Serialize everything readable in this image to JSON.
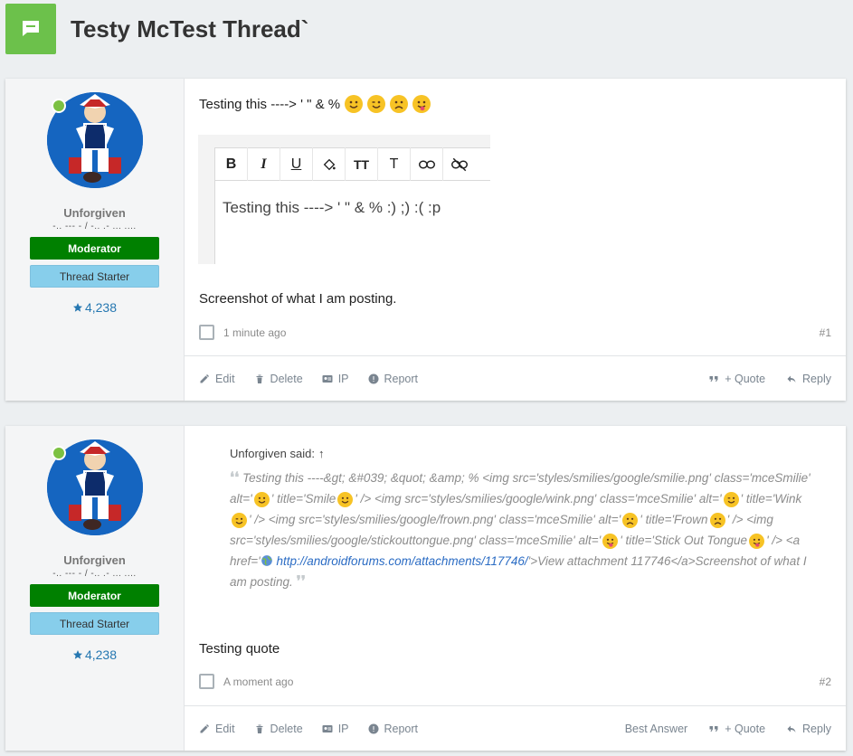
{
  "thread": {
    "title": "Testy McTest Thread`"
  },
  "posts": [
    {
      "user": {
        "name": "Unforgiven",
        "title": "-.. --- - / -.. .- ... ....",
        "badge_moderator": "Moderator",
        "badge_starter": "Thread Starter",
        "reputation": "4,238"
      },
      "text": "Testing this ----> ' \" & %",
      "editor": {
        "content": "Testing this ----> ' \" & % :) ;) :( :p"
      },
      "caption": "Screenshot of what I am posting.",
      "time": "1 minute ago",
      "number": "#1",
      "actions": {
        "edit": "Edit",
        "delete": "Delete",
        "ip": "IP",
        "report": "Report",
        "quote": "+ Quote",
        "reply": "Reply"
      }
    },
    {
      "user": {
        "name": "Unforgiven",
        "title": "-.. --- - / -.. .- ... ....",
        "badge_moderator": "Moderator",
        "badge_starter": "Thread Starter",
        "reputation": "4,238"
      },
      "quote": {
        "attribution": "Unforgiven said:",
        "arrow": "↑",
        "seg1": "Testing this ----&gt; &#039; &quot; &amp; % <img src='styles/smilies/google/smilie.png' class='mceSmilie' alt='",
        "seg2": "' title='Smile",
        "seg3": "' /> <img src='styles/smilies/google/wink.png' class='mceSmilie' alt='",
        "seg4": "' title='Wink",
        "seg5": "' /> <img src='styles/smilies/google/frown.png' class='mceSmilie' alt='",
        "seg6": "' title='Frown",
        "seg7": "' /> <img src='styles/smilies/google/stickouttongue.png' class='mceSmilie' alt='",
        "seg8": "' title='Stick Out Tongue",
        "seg9": "' /> <a href='",
        "link": "http://androidforums.com/attachments/117746/",
        "seg10": "'>View attachment 117746</a>Screenshot of what I am posting."
      },
      "reply": "Testing quote",
      "time": "A moment ago",
      "number": "#2",
      "actions": {
        "edit": "Edit",
        "delete": "Delete",
        "ip": "IP",
        "report": "Report",
        "best_answer": "Best Answer",
        "quote": "+ Quote",
        "reply": "Reply"
      }
    }
  ],
  "colors": {
    "accent": "#6cc14b",
    "moderator": "#008000",
    "starter": "#87ceeb",
    "link": "#2577b1"
  }
}
